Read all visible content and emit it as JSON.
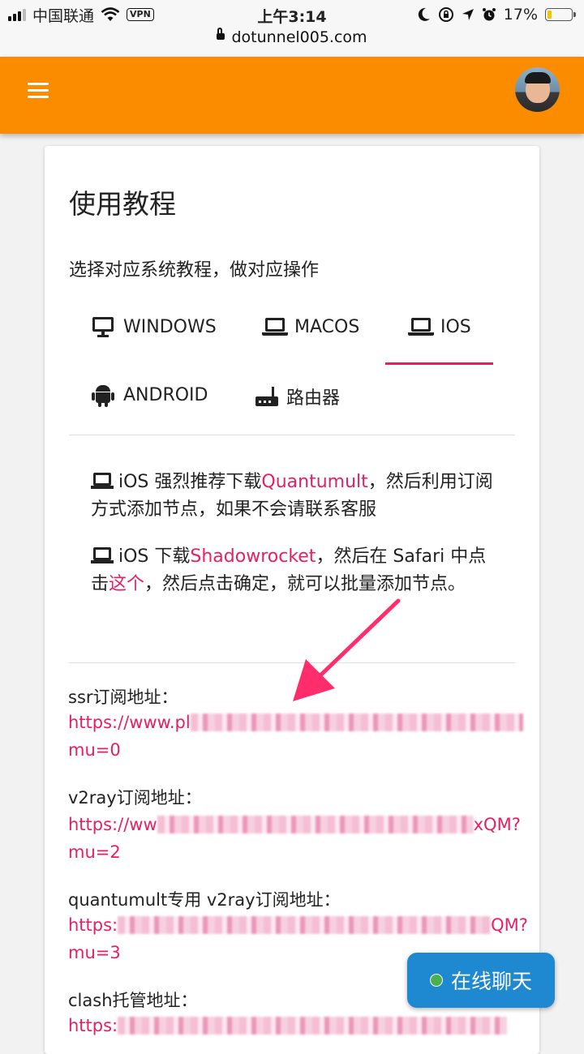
{
  "status_bar": {
    "carrier": "中国联通",
    "vpn": "VPN",
    "time": "上午3:14",
    "battery": "17%",
    "battery_level": 0.17,
    "url": "dotunnel005.com"
  },
  "card": {
    "title": "使用教程",
    "subtitle": "选择对应系统教程，做对应操作",
    "tabs": [
      {
        "label": "WINDOWS",
        "icon": "monitor-icon"
      },
      {
        "label": "MACOS",
        "icon": "laptop-icon"
      },
      {
        "label": "IOS",
        "icon": "laptop-icon",
        "active": true
      },
      {
        "label": "ANDROID",
        "icon": "android-icon"
      },
      {
        "label": "路由器",
        "icon": "router-icon"
      }
    ],
    "para1": {
      "pre": "iOS 强烈推荐下载",
      "link": "Quantumult",
      "post": "，然后利用订阅方式添加节点，如果不会请联系客服"
    },
    "para2": {
      "pre": "iOS 下载",
      "link1": "Shadowrocket",
      "mid": "，然后在 Safari 中点击",
      "link2": "这个",
      "post": "，然后点击确定，就可以批量添加节点。"
    },
    "subscriptions": [
      {
        "label": "ssr订阅地址：",
        "url_start": "https://www.pl",
        "url_end": "",
        "url_line2": "mu=0"
      },
      {
        "label": "v2ray订阅地址：",
        "url_start": "https://ww",
        "url_end": "xQM?",
        "url_line2": "mu=2"
      },
      {
        "label": "quantumult专用 v2ray订阅地址：",
        "url_start": "https:",
        "url_end": "QM?",
        "url_line2": "mu=3"
      },
      {
        "label": "clash托管地址：",
        "url_start": "https:",
        "url_end": "",
        "url_line2": ""
      }
    ]
  },
  "chat_button": {
    "label": "在线聊天"
  },
  "colors": {
    "app_bar": "#fb8c00",
    "accent": "#e91e63",
    "chat": "#1e88d0"
  }
}
